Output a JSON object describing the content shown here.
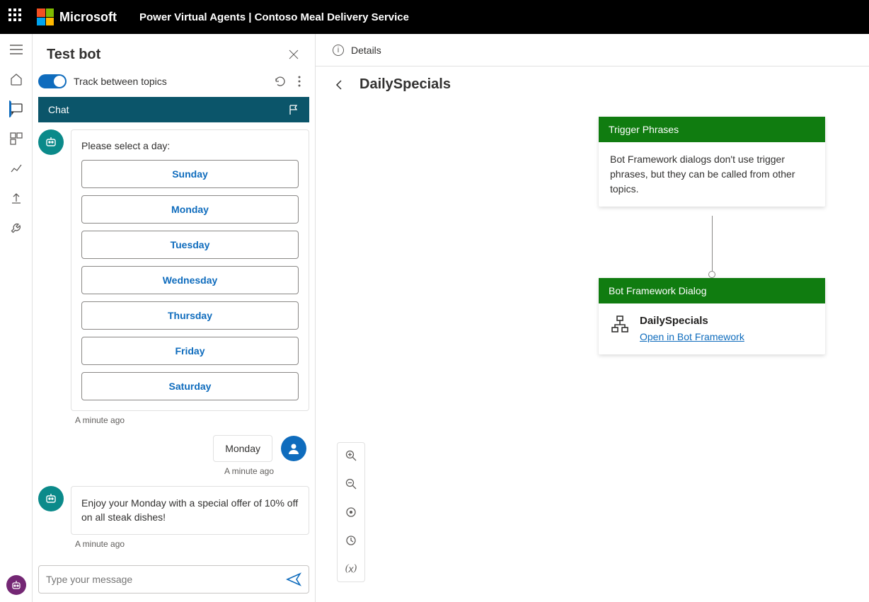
{
  "header": {
    "brand": "Microsoft",
    "title": "Power Virtual Agents | Contoso Meal Delivery Service"
  },
  "test_panel": {
    "title": "Test bot",
    "toggle_label": "Track between topics",
    "chat_tab": "Chat",
    "prompt": "Please select a day:",
    "options": [
      "Sunday",
      "Monday",
      "Tuesday",
      "Wednesday",
      "Thursday",
      "Friday",
      "Saturday"
    ],
    "timestamp1": "A minute ago",
    "user_reply": "Monday",
    "timestamp2": "A minute ago",
    "bot_response": "Enjoy your Monday with a special offer of 10% off on all steak dishes!",
    "timestamp3": "A minute ago",
    "input_placeholder": "Type your message"
  },
  "main": {
    "details_label": "Details",
    "topic_name": "DailySpecials",
    "trigger_node": {
      "title": "Trigger Phrases",
      "body": "Bot Framework dialogs don't use trigger phrases, but they can be called from other topics."
    },
    "dialog_node": {
      "title": "Bot Framework Dialog",
      "name": "DailySpecials",
      "link": "Open in Bot Framework"
    }
  },
  "icons": {
    "hamburger": "hamburger-icon",
    "home": "home-icon",
    "chat": "chat-icon",
    "topics": "topics-icon",
    "analytics": "analytics-icon",
    "publish": "publish-icon",
    "settings": "settings-icon"
  }
}
